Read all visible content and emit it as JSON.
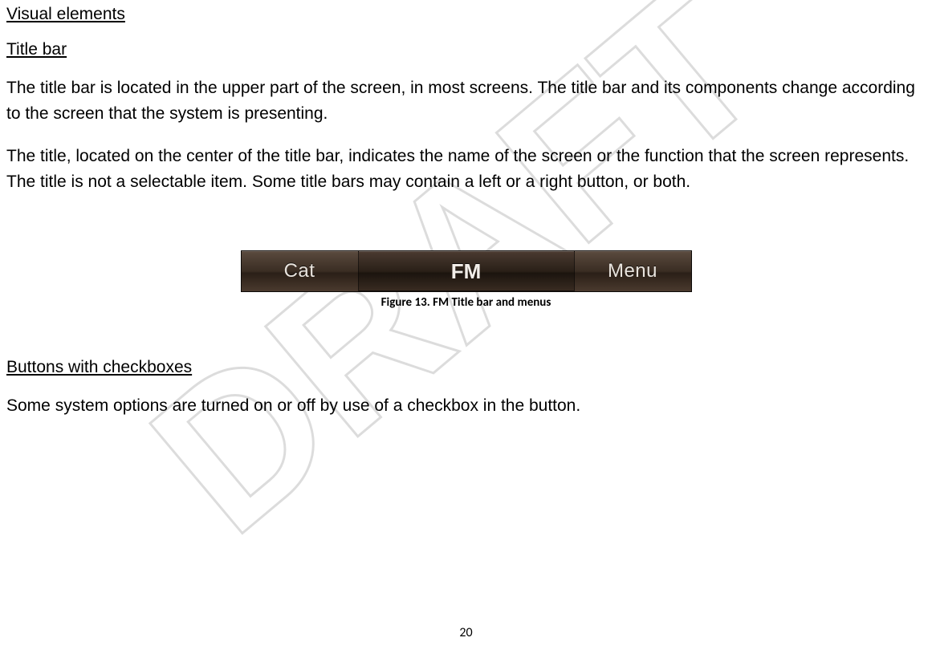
{
  "watermark": {
    "text": "DRAFT"
  },
  "heading_visual_elements": "Visual elements",
  "heading_title_bar": "Title bar",
  "para_titlebar_1": "The title bar is located in the upper part of the screen, in most screens. The title bar and its components change according to the screen that the system is presenting.",
  "para_titlebar_2": "The title, located on the center of the title bar, indicates the name of the screen or the function that the screen represents. The title is not a selectable item. Some title bars may contain a left or a right button, or both.",
  "titlebar": {
    "left_button": "Cat",
    "title": "FM",
    "right_button": "Menu"
  },
  "figure_caption": "Figure 13. FM Title bar and menus",
  "heading_buttons_checkboxes": "Buttons with checkboxes",
  "para_checkboxes_1": "Some system options are turned on or off by use of a checkbox in the button.",
  "page_number": "20"
}
